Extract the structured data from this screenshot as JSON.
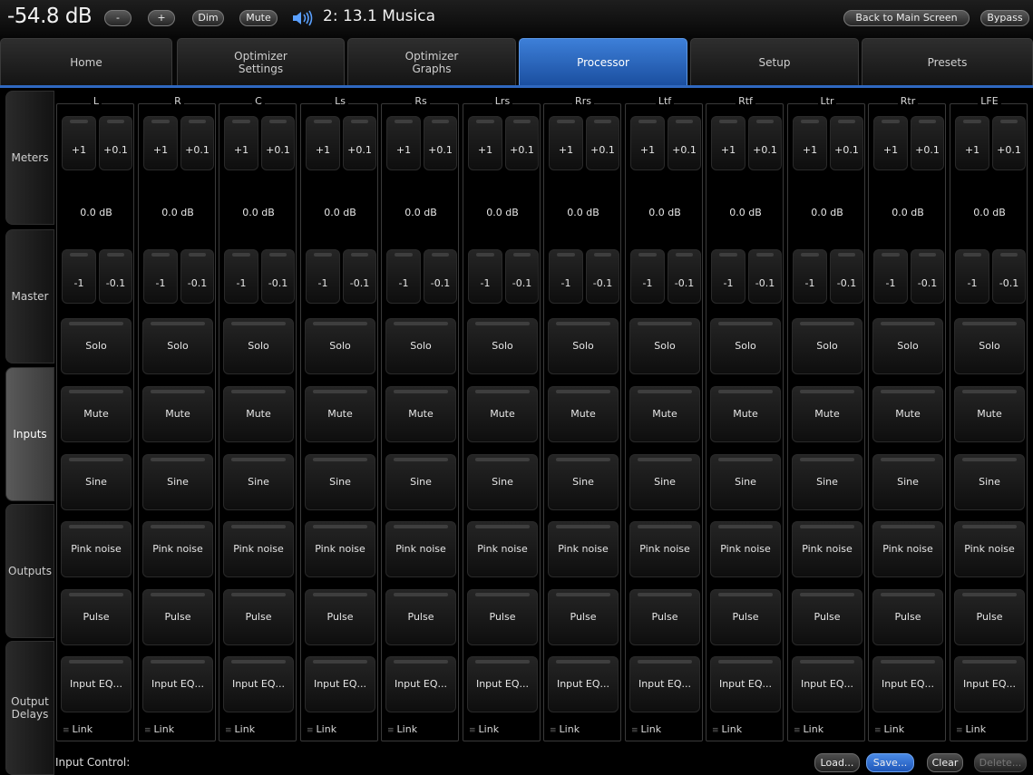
{
  "top_bar": {
    "volume": "-54.8 dB",
    "vol_down": "-",
    "vol_up": "+",
    "dim": "Dim",
    "mute": "Mute",
    "preset": "2: 13.1 Musica",
    "back": "Back to Main Screen",
    "bypass": "Bypass"
  },
  "tabs": [
    {
      "label": "Home"
    },
    {
      "label": "Optimizer\nSettings"
    },
    {
      "label": "Optimizer\nGraphs"
    },
    {
      "label": "Processor",
      "active": true
    },
    {
      "label": "Setup"
    },
    {
      "label": "Presets"
    }
  ],
  "sidebar": [
    {
      "label": "Meters"
    },
    {
      "label": "Master"
    },
    {
      "label": "Inputs",
      "active": true
    },
    {
      "label": "Outputs"
    },
    {
      "label": "Output\nDelays"
    }
  ],
  "channels": [
    "L",
    "R",
    "C",
    "Ls",
    "Rs",
    "Lrs",
    "Rrs",
    "Ltf",
    "Rtf",
    "Ltr",
    "Rtr",
    "LFE"
  ],
  "channel_controls": {
    "plus1": "+1",
    "plus01": "+0.1",
    "level": "0.0 dB",
    "minus1": "-1",
    "minus01": "-0.1",
    "solo": "Solo",
    "mute": "Mute",
    "sine": "Sine",
    "pink": "Pink noise",
    "pulse": "Pulse",
    "eq": "Input EQ...",
    "link": "Link"
  },
  "bottom": {
    "label": "Input Control:",
    "load": "Load...",
    "save": "Save...",
    "clear": "Clear",
    "delete": "Delete..."
  },
  "colors": {
    "accent": "#2f68c0",
    "background": "#000000"
  }
}
